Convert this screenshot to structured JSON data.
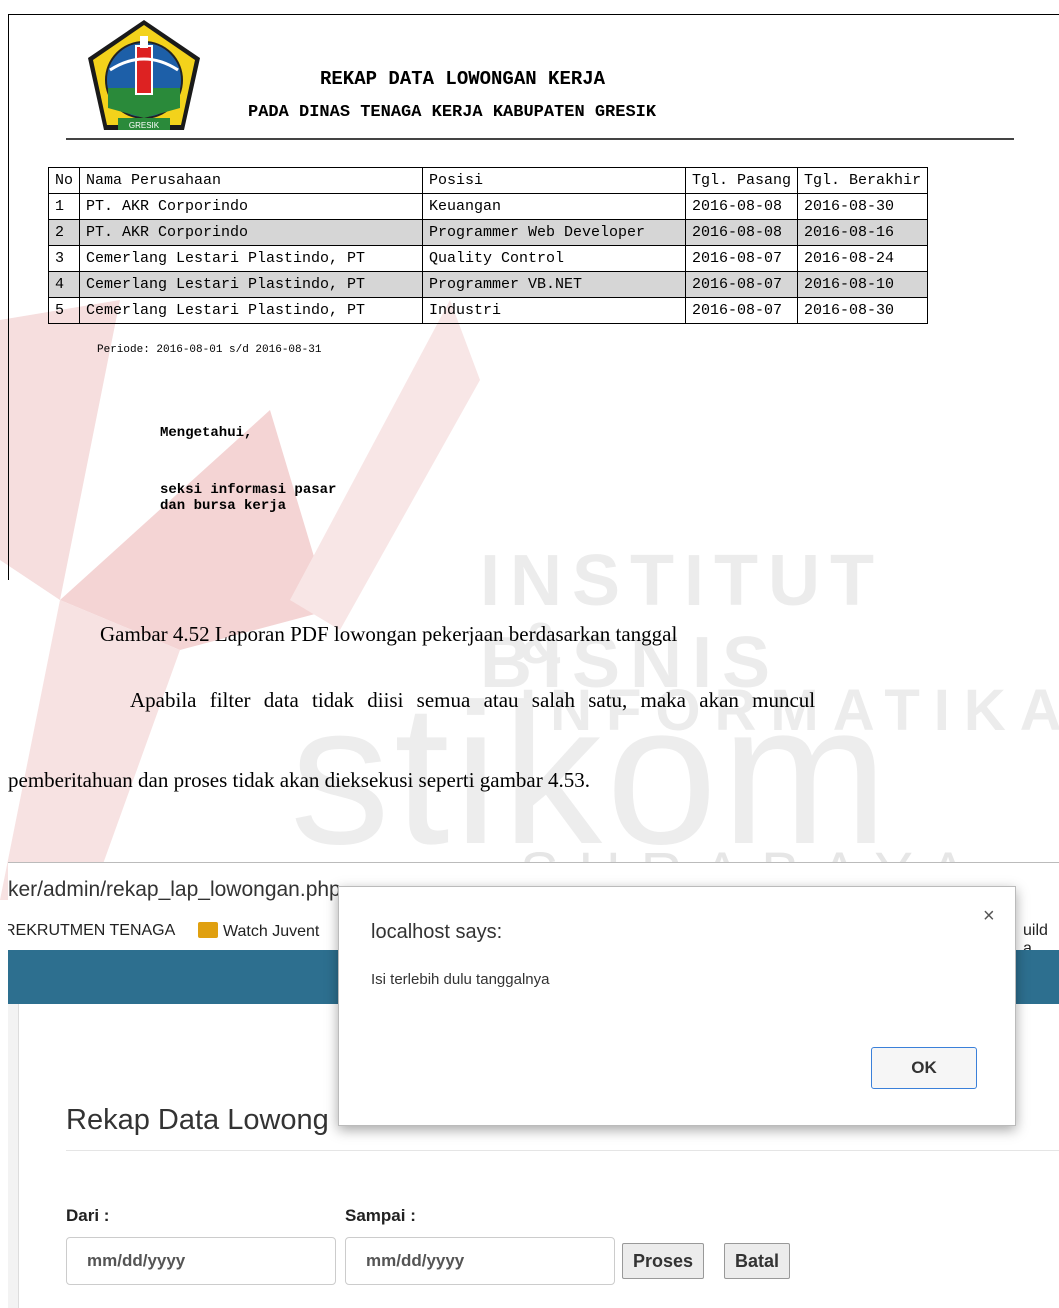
{
  "watermark": {
    "line1": "INSTITUT BISNIS",
    "line2": "& INFORMATIKA",
    "brand": "stikom",
    "city": "SURABAYA"
  },
  "report": {
    "logo_text": "GRESIK",
    "title": "REKAP DATA LOWONGAN KERJA",
    "subtitle": "PADA DINAS TENAGA KERJA KABUPATEN GRESIK",
    "columns": [
      "No",
      "Nama Perusahaan",
      "Posisi",
      "Tgl. Pasang",
      "Tgl. Berakhir"
    ],
    "rows": [
      [
        "1",
        "PT. AKR Corporindo",
        "Keuangan",
        "2016-08-08",
        "2016-08-30"
      ],
      [
        "2",
        "PT. AKR Corporindo",
        "Programmer Web Developer",
        "2016-08-08",
        "2016-08-16"
      ],
      [
        "3",
        "Cemerlang Lestari Plastindo, PT",
        "Quality Control",
        "2016-08-07",
        "2016-08-24"
      ],
      [
        "4",
        "Cemerlang Lestari Plastindo, PT",
        "Programmer VB.NET",
        "2016-08-07",
        "2016-08-10"
      ],
      [
        "5",
        "Cemerlang Lestari Plastindo, PT",
        "Industri",
        "2016-08-07",
        "2016-08-30"
      ]
    ],
    "periode": "Periode: 2016-08-01 s/d 2016-08-31",
    "sign_label": "Mengetahui,",
    "sign_line1": "seksi informasi pasar",
    "sign_line2": "dan bursa kerja"
  },
  "caption": "Gambar 4.52 Laporan PDF lowongan pekerjaan berdasarkan tanggal",
  "paragraph": {
    "line1": "Apabila filter data tidak diisi semua atau salah satu, maka akan muncul",
    "line2": "pemberitahuan dan proses tidak akan dieksekusi seperti gambar 4.53."
  },
  "browser": {
    "address": "ker/admin/rekap_lap_lowongan.php",
    "bookmarks": [
      "REKRUTMEN TENAGA",
      "Watch Juvent",
      "uild a"
    ],
    "page_title": "Rekap Data Lowong",
    "dari_label": "Dari :",
    "sampai_label": "Sampai :",
    "dari_placeholder": "mm/dd/yyyy",
    "sampai_placeholder": "mm/dd/yyyy",
    "proses_label": "Proses",
    "batal_label": "Batal",
    "navbar_color": "#2d6f8f"
  },
  "dialog": {
    "title": "localhost says:",
    "message": "Isi terlebih dulu tanggalnya",
    "close": "×",
    "ok_label": "OK"
  }
}
